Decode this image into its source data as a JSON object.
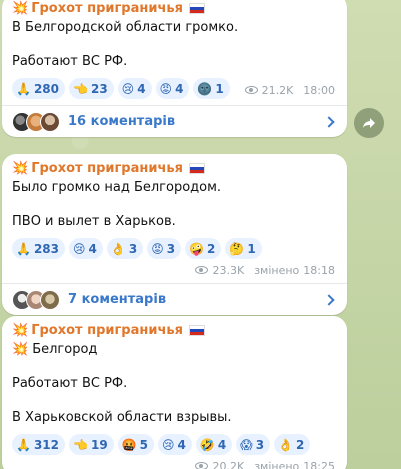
{
  "channel": {
    "name": "Грохот приграничья"
  },
  "posts": [
    {
      "lines": [
        "В Белгородской области громко.",
        "",
        "Работают ВС РФ."
      ],
      "reactions": [
        {
          "emoji": "🙏",
          "count": "280"
        },
        {
          "emoji": "👈",
          "count": "23"
        },
        {
          "emoji": "😢",
          "count": "4"
        },
        {
          "emoji": "😡",
          "count": "4"
        },
        {
          "emoji": "🌚",
          "count": "1"
        }
      ],
      "views": "21.2K",
      "edited": "",
      "time": "18:00",
      "comments": "16 коментарів"
    },
    {
      "lines": [
        "Было громко над Белгородом.",
        "",
        "ПВО и вылет в Харьков."
      ],
      "reactions": [
        {
          "emoji": "🙏",
          "count": "283"
        },
        {
          "emoji": "😢",
          "count": "4"
        },
        {
          "emoji": "👌",
          "count": "3"
        },
        {
          "emoji": "😡",
          "count": "3"
        },
        {
          "emoji": "🤪",
          "count": "2"
        },
        {
          "emoji": "🤔",
          "count": "1"
        }
      ],
      "views": "23.3K",
      "edited": "змінено",
      "time": "18:18",
      "comments": "7 коментарів"
    },
    {
      "first_line": "Белгород",
      "lines": [
        "",
        "Работают ВС РФ.",
        "",
        "В Харьковской области взрывы."
      ],
      "reactions": [
        {
          "emoji": "🙏",
          "count": "312"
        },
        {
          "emoji": "👈",
          "count": "19"
        },
        {
          "emoji": "🤬",
          "count": "5"
        },
        {
          "emoji": "😢",
          "count": "4"
        },
        {
          "emoji": "🤣",
          "count": "4"
        },
        {
          "emoji": "😱",
          "count": "3"
        },
        {
          "emoji": "👌",
          "count": "2"
        }
      ],
      "views": "20.2K",
      "edited": "змінено",
      "time": "18:25"
    }
  ],
  "colors": {
    "channel": "#e0772b",
    "link": "#3a78c9",
    "reaction_bg": "#e8f1ff"
  },
  "icons": {
    "channel_prefix": "💥",
    "share": "share-arrow-icon",
    "views": "eye-icon"
  }
}
